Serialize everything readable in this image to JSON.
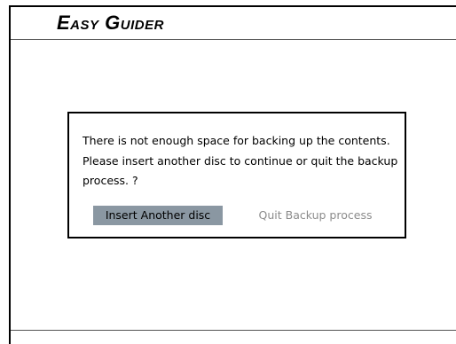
{
  "app": {
    "title": "Easy Guider"
  },
  "dialog": {
    "message": "There is not enough space for backing up the contents. Please insert another disc to continue or quit the backup process. ?",
    "buttons": {
      "insert_label": "Insert Another disc",
      "quit_label": "Quit Backup process"
    },
    "selected_button": "insert"
  },
  "colors": {
    "selected_button_bg": "#8a97a2",
    "unselected_button_text": "#8c8c8c",
    "frame": "#000000"
  }
}
